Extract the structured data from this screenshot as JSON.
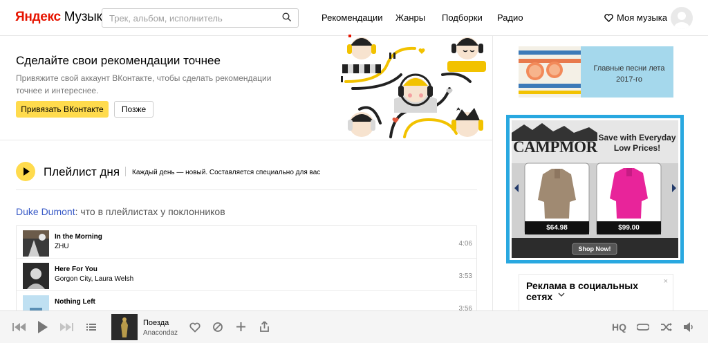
{
  "header": {
    "logo_yandex": "Яндекс",
    "logo_music": "Музыка",
    "search_placeholder": "Трек, альбом, исполнитель",
    "nav": [
      "Рекомендации",
      "Жанры",
      "Подборки",
      "Радио"
    ],
    "my_music": "Моя музыка"
  },
  "promo": {
    "title": "Сделайте свои рекомендации точнее",
    "description": "Привяжите свой аккаунт ВКонтакте, чтобы сделать рекомендации точнее и интереснее.",
    "bind_button": "Привязать ВКонтакте",
    "later_button": "Позже"
  },
  "playlist_of_day": {
    "title": "Плейлист дня",
    "subtitle": "Каждый день — новый. Составляется специально для вас"
  },
  "fans": {
    "artist": "Duke Dumont",
    "text": ": что в плейлистах у поклонников"
  },
  "tracks": [
    {
      "name": "In the Morning",
      "artist": "ZHU",
      "duration": "4:06"
    },
    {
      "name": "Here For You",
      "artist": "Gorgon City, Laura Welsh",
      "duration": "3:53"
    },
    {
      "name": "Nothing Left",
      "artist": "",
      "duration": "3:56"
    }
  ],
  "sidebar": {
    "summer_ad": "Главные песни лета 2017-го",
    "campmor": {
      "brand": "CAMPMOR",
      "tagline": "Save with Everyday Low Prices!",
      "price1": "$64.98",
      "price2": "$99.00",
      "shop_now": "Shop Now!"
    },
    "social_ad_title": "Реклама в социальных сетях",
    "social_close": "×"
  },
  "player": {
    "track": "Поезда",
    "artist": "Anacondaz",
    "hq": "HQ"
  },
  "colors": {
    "accent_yellow": "#ffdb4d",
    "logo_red": "#e61400",
    "link_blue": "#3a5bc7",
    "ad_border": "#29a8e0"
  }
}
